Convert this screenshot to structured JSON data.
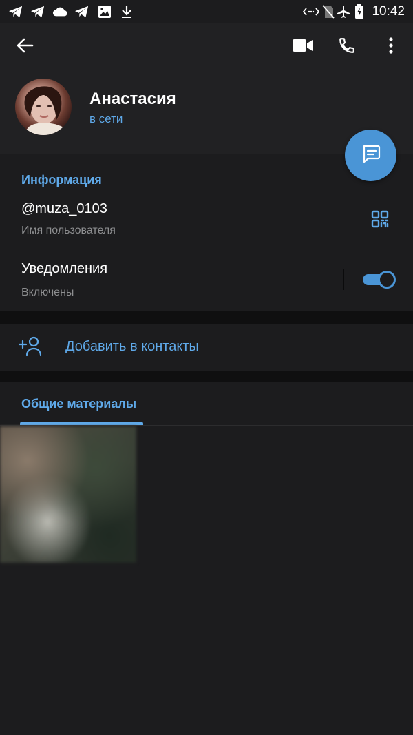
{
  "status_bar": {
    "time": "10:42",
    "left_icons": [
      "telegram-icon",
      "telegram-icon",
      "cloud-icon",
      "telegram-icon",
      "image-icon",
      "download-icon"
    ],
    "right_icons": [
      "data-saver-icon",
      "no-sim-icon",
      "airplane-icon",
      "battery-charging-icon"
    ]
  },
  "header": {
    "back_icon": "arrow-left-icon",
    "actions": [
      "video-call-icon",
      "phone-icon",
      "more-vert-icon"
    ],
    "profile": {
      "name": "Анастасия",
      "status": "в сети"
    }
  },
  "fab": {
    "icon": "message-icon"
  },
  "info": {
    "section_title": "Информация",
    "username": {
      "value": "@muza_0103",
      "caption": "Имя пользователя"
    },
    "notifications": {
      "label": "Уведомления",
      "caption": "Включены",
      "enabled": true
    }
  },
  "add_contact": {
    "label": "Добавить в контакты"
  },
  "shared_media": {
    "tab_label": "Общие материалы",
    "items_count": 1
  },
  "colors": {
    "accent": "#5fa9e9",
    "fab": "#4a95d6",
    "background": "#1c1c1e",
    "header_bg": "#212123"
  }
}
